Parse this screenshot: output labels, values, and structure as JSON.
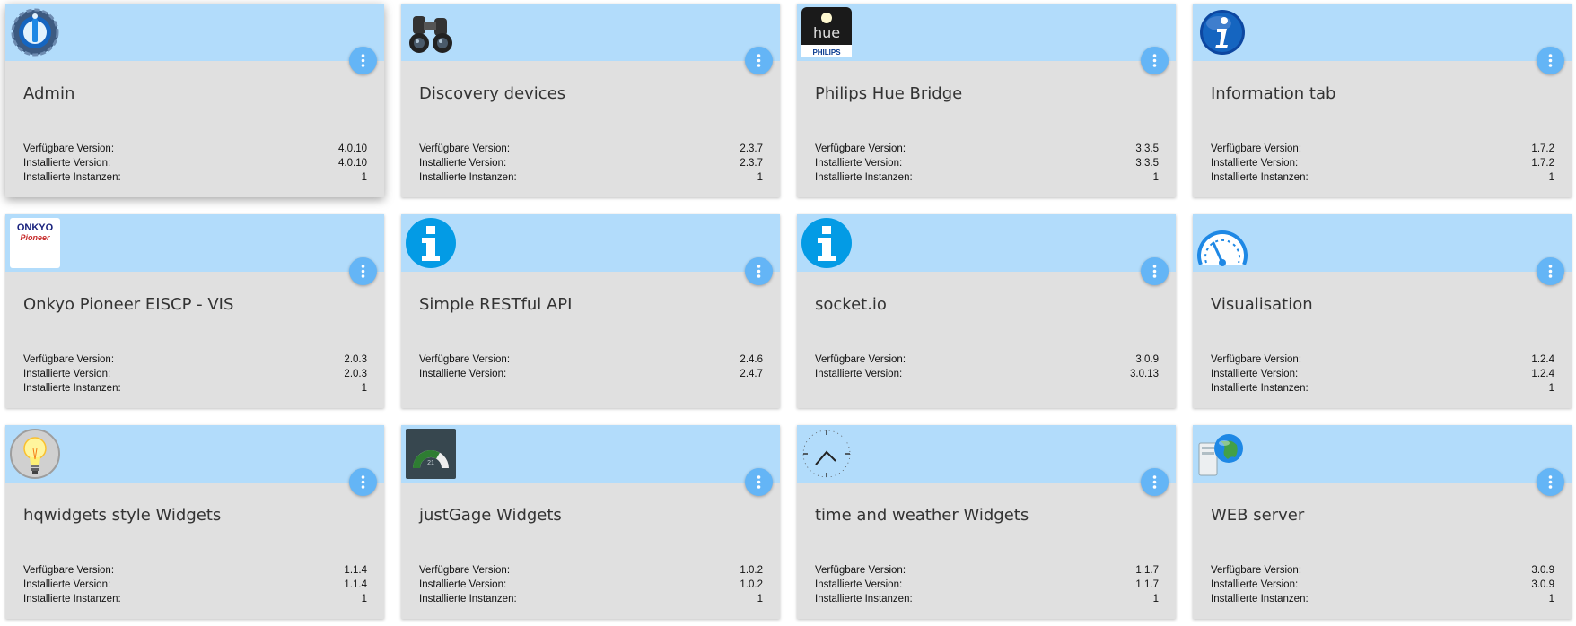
{
  "labels": {
    "available": "Verfügbare Version:",
    "installed": "Installierte Version:",
    "instances": "Installierte Instanzen:"
  },
  "colors": {
    "card_header": "#b2dcfb",
    "card_body": "#e0e0e0",
    "menu_button": "#64b5f6"
  },
  "adapters": [
    {
      "title": "Admin",
      "icon": "iobroker-admin-icon",
      "available": "4.0.10",
      "installed": "4.0.10",
      "instances": "1"
    },
    {
      "title": "Discovery devices",
      "icon": "binoculars-icon",
      "available": "2.3.7",
      "installed": "2.3.7",
      "instances": "1"
    },
    {
      "title": "Philips Hue Bridge",
      "icon": "hue-bulb-icon",
      "icon_text": "hue",
      "icon_brand": "PHILIPS",
      "available": "3.3.5",
      "installed": "3.3.5",
      "instances": "1"
    },
    {
      "title": "Information tab",
      "icon": "info-blue-icon",
      "available": "1.7.2",
      "installed": "1.7.2",
      "instances": "1"
    },
    {
      "title": "Onkyo Pioneer EISCP - VIS",
      "icon": "onkyo-pioneer-logo",
      "icon_text": "ONKYO",
      "icon_brand": "Pioneer",
      "available": "2.0.3",
      "installed": "2.0.3",
      "instances": "1"
    },
    {
      "title": "Simple RESTful API",
      "icon": "info-circle-icon",
      "available": "2.4.6",
      "installed": "2.4.7"
    },
    {
      "title": "socket.io",
      "icon": "info-circle-icon",
      "available": "3.0.9",
      "installed": "3.0.13"
    },
    {
      "title": "Visualisation",
      "icon": "gauge-icon",
      "available": "1.2.4",
      "installed": "1.2.4",
      "instances": "1"
    },
    {
      "title": "hqwidgets style Widgets",
      "icon": "lightbulb-icon",
      "available": "1.1.4",
      "installed": "1.1.4",
      "instances": "1"
    },
    {
      "title": "justGage Widgets",
      "icon": "justgage-icon",
      "icon_text": "21",
      "available": "1.0.2",
      "installed": "1.0.2",
      "instances": "1"
    },
    {
      "title": "time and weather Widgets",
      "icon": "clock-icon",
      "available": "1.1.7",
      "installed": "1.1.7",
      "instances": "1"
    },
    {
      "title": "WEB server",
      "icon": "web-server-icon",
      "available": "3.0.9",
      "installed": "3.0.9",
      "instances": "1"
    }
  ]
}
